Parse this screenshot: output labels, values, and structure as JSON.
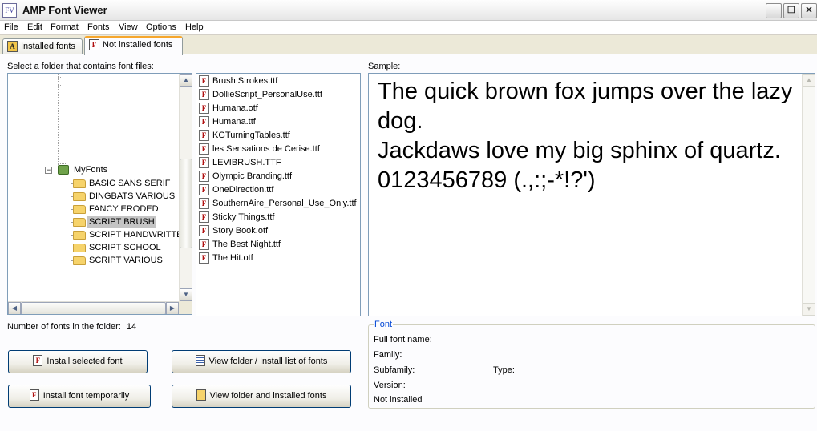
{
  "window": {
    "title": "AMP Font Viewer",
    "app_icon": "FV",
    "controls": [
      "_",
      "❐",
      "✕"
    ]
  },
  "menu": [
    "File",
    "Edit",
    "Format",
    "Fonts",
    "View",
    "Options",
    "Help"
  ],
  "tabs": [
    {
      "label": "Installed fonts",
      "icon": "installed-fonts-icon",
      "active": false
    },
    {
      "label": "Not installed fonts",
      "icon": "font-file-icon",
      "active": true
    }
  ],
  "folder_panel": {
    "label": "Select a folder that contains font files:",
    "root": "MyFonts",
    "folders": [
      "BASIC SANS SERIF",
      "DINGBATS VARIOUS",
      "FANCY ERODED",
      "SCRIPT BRUSH",
      "SCRIPT HANDWRITTEN",
      "SCRIPT SCHOOL",
      "SCRIPT VARIOUS"
    ],
    "selected": "SCRIPT BRUSH"
  },
  "file_list": [
    "Brush Strokes.ttf",
    "DollieScript_PersonalUse.ttf",
    "Humana.otf",
    "Humana.ttf",
    "KGTurningTables.ttf",
    "les Sensations de Cerise.ttf",
    "LEVIBRUSH.TTF",
    "Olympic Branding.ttf",
    "OneDirection.ttf",
    "SouthernAire_Personal_Use_Only.ttf",
    "Sticky Things.ttf",
    "Story Book.otf",
    "The Best Night.ttf",
    "The Hit.otf"
  ],
  "file_icon_glyph": "F",
  "sample": {
    "label": "Sample:",
    "text": "The quick brown fox jumps over the lazy dog.\nJackdaws love my big sphinx of quartz.\n0123456789 (.,:;-*!?')"
  },
  "count": {
    "label": "Number of fonts in the folder:",
    "value": "14"
  },
  "buttons": {
    "install_selected": "Install selected font",
    "install_temporarily": "Install font temporarily",
    "view_install_list": "View folder / Install list of fonts",
    "view_installed": "View folder and installed fonts"
  },
  "font_info": {
    "legend": "Font",
    "full_name_label": "Full font name:",
    "family_label": "Family:",
    "subfamily_label": "Subfamily:",
    "type_label": "Type:",
    "version_label": "Version:",
    "status": "Not installed"
  },
  "colors": {
    "accent_tab": "#f6a62c",
    "group_legend": "#0046d5",
    "folder": "#f6d36b",
    "selection": "#c4c4c4"
  }
}
